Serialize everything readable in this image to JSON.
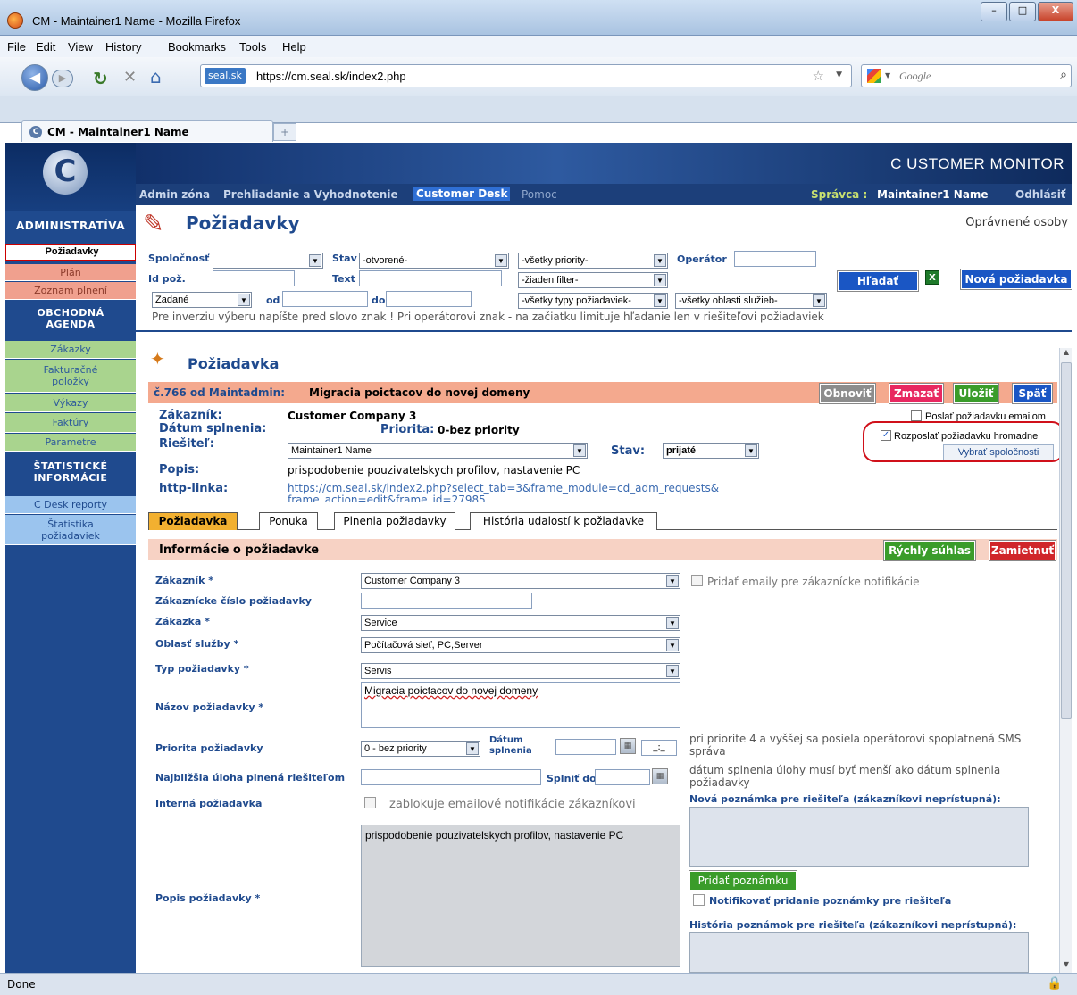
{
  "window": {
    "title": "CM - Maintainer1 Name - Mozilla Firefox",
    "min": "–",
    "max": "□",
    "close": "X"
  },
  "menu": [
    "File",
    "Edit",
    "View",
    "History",
    "Bookmarks",
    "Tools",
    "Help"
  ],
  "nav": {
    "site_badge": "seal.sk",
    "url": "https://cm.seal.sk/index2.php",
    "search_placeholder": "Google"
  },
  "tab": {
    "label": "CM - Maintainer1 Name",
    "new_tab": "+"
  },
  "brand": "C USTOMER MONITOR",
  "logo_letter": "C",
  "topnav": {
    "admin": "Admin zóna",
    "review": "Prehliadanie a Vyhodnotenie",
    "desk": "Customer Desk",
    "help": "Pomoc",
    "admin_label": "Správca :",
    "user": "Maintainer1 Name",
    "logout": "Odhlásiť"
  },
  "sidebar": {
    "admin_head": "ADMINISTRATÍVA",
    "items_admin": [
      "Požiadavky",
      "Plán",
      "Zoznam plnení"
    ],
    "agenda_head": "OBCHODNÁ AGENDA",
    "items_agenda": [
      "Zákazky",
      "Fakturačné položky",
      "Výkazy",
      "Faktúry",
      "Parametre"
    ],
    "stats_head": "ŠTATISTICKÉ INFORMÁCIE",
    "items_stats": [
      "C Desk reporty",
      "Štatistika požiadaviek"
    ]
  },
  "header": {
    "title": "Požiadavky",
    "authorized": "Oprávnené osoby"
  },
  "filters": {
    "company_lbl": "Spoločnosť",
    "state_lbl": "Stav",
    "state_val": "-otvorené-",
    "priority_val": "-všetky priority-",
    "operator_lbl": "Operátor",
    "id_lbl": "Id pož.",
    "text_lbl": "Text",
    "filter_val": "-žiaden filter-",
    "date_type": "Zadané",
    "from_lbl": "od",
    "to_lbl": "do",
    "types_val": "-všetky typy požiadaviek-",
    "areas_val": "-všetky oblasti služieb-",
    "search_btn": "Hľadať",
    "new_btn": "Nová požiadavka",
    "hint": "Pre inverziu výberu napíšte pred slovo znak ! Pri operátorovi znak - na začiatku limituje hľadanie len v riešiteľovi požiadaviek"
  },
  "request": {
    "section_title": "Požiadavka",
    "number": "č.766 od Maintadmin:",
    "subject": "Migracia poictacov do novej domeny",
    "btn_refresh": "Obnoviť",
    "btn_delete": "Zmazať",
    "btn_save": "Uložiť",
    "btn_back": "Späť",
    "customer_lbl": "Zákazník:",
    "customer_val": "Customer Company 3",
    "due_lbl": "Dátum splnenia:",
    "priority_lbl": "Priorita:",
    "priority_val": "0-bez priority",
    "solver_lbl": "Riešiteľ:",
    "solver_val": "Maintainer1 Name",
    "state_lbl": "Stav:",
    "state_val": "prijaté",
    "desc_lbl": "Popis:",
    "desc_val": "prispodobenie pouzivatelskych profilov, nastavenie PC",
    "link_lbl": "http-linka:",
    "link_val1": "https://cm.seal.sk/index2.php?select_tab=3&frame_module=cd_adm_requests&",
    "link_val2": "frame_action=edit&frame_id=27985",
    "send_email": "Poslať požiadavku emailom",
    "bulk_send": "Rozposlať požiadavku hromadne",
    "choose_companies": "Vybrať spoločnosti"
  },
  "tabs": [
    "Požiadavka",
    "Ponuka",
    "Plnenia požiadavky",
    "História udalostí k požiadavke"
  ],
  "info": {
    "title": "Informácie o požiadavke",
    "quick_approve": "Rýchly súhlas",
    "reject": "Zamietnuť",
    "customer_lbl": "Zákazník *",
    "customer_val": "Customer Company 3",
    "add_emails": "Pridať emaily pre zákaznícke notifikácie",
    "cust_no_lbl": "Zákaznícke číslo požiadavky",
    "order_lbl": "Zákazka *",
    "order_val": "Service",
    "area_lbl": "Oblasť služby *",
    "area_val": "Počítačová sieť, PC,Server",
    "type_lbl": "Typ požiadavky *",
    "type_val": "Servis",
    "name_lbl": "Názov požiadavky *",
    "name_val": "Migracia poictacov do novej domeny",
    "priority_lbl": "Priorita požiadavky",
    "priority_val": "0 - bez priority",
    "due_lbl": "Dátum splnenia",
    "due_time": "_:_",
    "prio_hint": "pri priorite 4 a vyššej sa posiela operátorovi spoplatnená SMS správa",
    "next_task_lbl": "Najbližšia úloha plnená riešiteľom",
    "fulfil_lbl": "Splniť do",
    "due_hint": "dátum splnenia úlohy musí byť menší ako dátum splnenia požiadavky",
    "internal_lbl": "Interná požiadavka",
    "internal_hint": "zablokuje emailové notifikácie zákazníkovi",
    "new_note_lbl": "Nová poznámka pre riešiteľa (zákazníkovi neprístupná):",
    "desc_val": "prispodobenie pouzivatelskych profilov, nastavenie PC",
    "add_note_btn": "Pridať poznámku",
    "notify_lbl": "Notifikovať pridanie poznámky pre riešiteľa",
    "desc_lbl": "Popis požiadavky *",
    "history_lbl": "História poznámok pre riešiteľa (zákazníkovi neprístupná):"
  },
  "status": {
    "text": "Done"
  },
  "colors": {
    "sidebar": "#1f4a8e",
    "green_item": "#a9d48e",
    "pink_item": "#f0a08e",
    "title_bar": "#f4a98e",
    "info_bar": "#f7d2c4",
    "accent_blue": "#1a56c4",
    "annotation": "#d0101a"
  }
}
